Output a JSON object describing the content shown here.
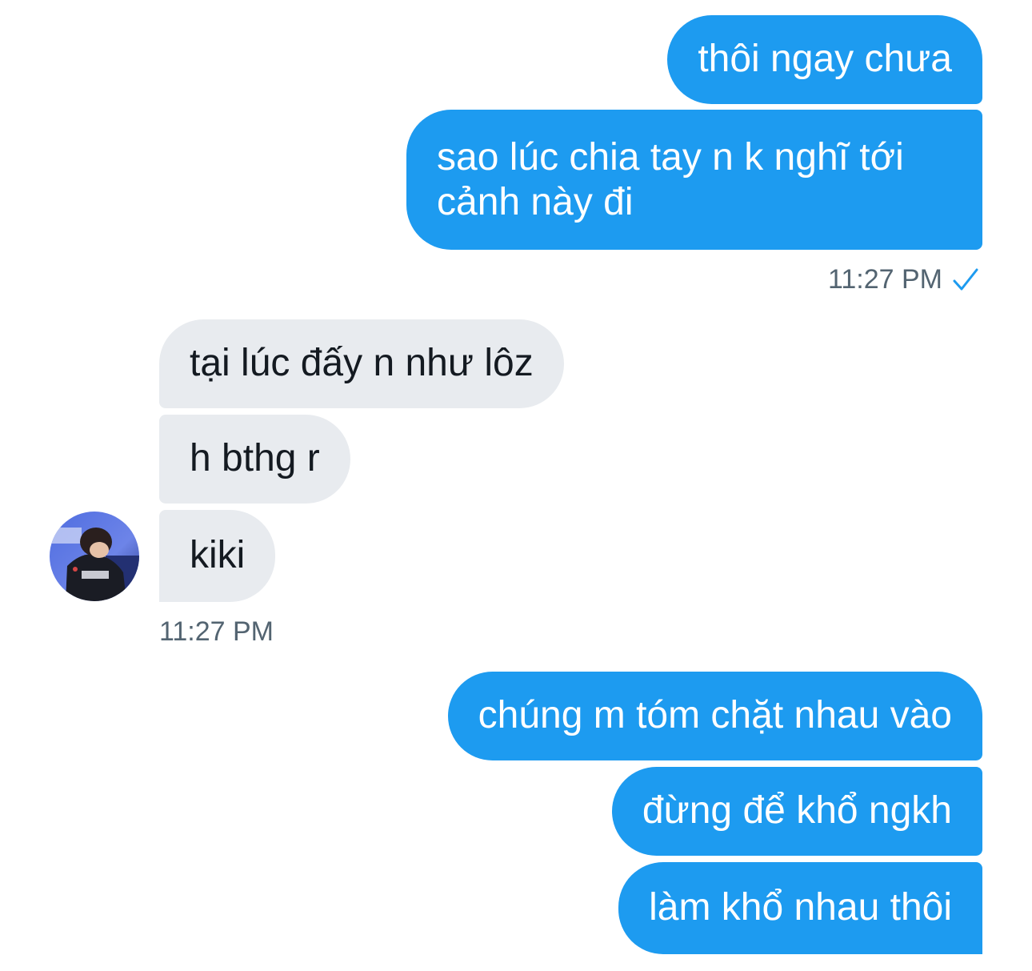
{
  "conversation": {
    "group1": {
      "messages": [
        "thôi ngay chưa",
        "sao lúc chia tay n k nghĩ tới\ncảnh này đi"
      ],
      "timestamp": "11:27 PM",
      "status_icon": "checkmark-icon"
    },
    "group2": {
      "messages": [
        "tại lúc đấy n như lôz",
        "h bthg r",
        "kiki"
      ],
      "timestamp": "11:27 PM",
      "avatar_icon": "user-avatar"
    },
    "group3": {
      "messages": [
        "chúng m tóm chặt nhau vào",
        "đừng để khổ ngkh",
        "làm khổ nhau thôi"
      ]
    }
  },
  "colors": {
    "outgoing_bubble": "#1d9bf0",
    "incoming_bubble": "#e8ebef",
    "timestamp": "#536471",
    "check": "#1d9bf0"
  }
}
